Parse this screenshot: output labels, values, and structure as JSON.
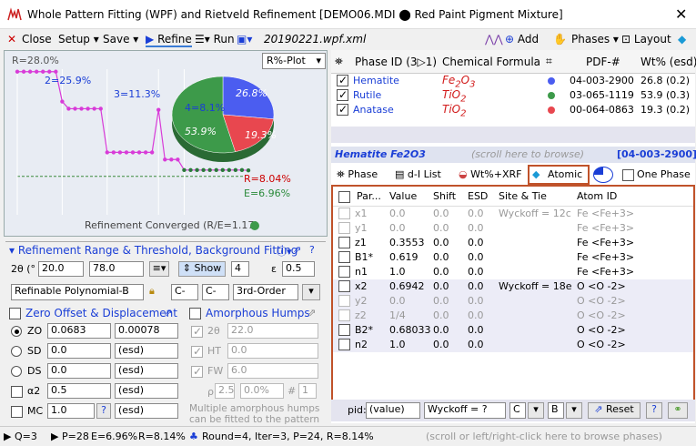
{
  "window": {
    "title": "Whole Pattern Fitting (WPF) and Rietveld Refinement [DEMO06.MDI ⬤ Red Paint Pigment Mixture]",
    "close": "✕"
  },
  "toolbar": {
    "close": "Close",
    "setup": "Setup",
    "save": "Save",
    "refine": "Refine",
    "run": "Run",
    "filename": "20190221.wpf.xml",
    "add": "Add",
    "phases": "Phases",
    "layout": "Layout"
  },
  "plot": {
    "mode": "R%-Plot",
    "r_start": "R=28.0%",
    "label_2": "2=25.9%",
    "label_3": "3=11.3%",
    "label_4": "4=8.1%",
    "r_final": "R=8.04%",
    "e_final": "E=6.96%",
    "status": "Refinement Converged (R/E=1.17)",
    "pie_values": [
      {
        "label": "26.8%",
        "value": 26.8,
        "color": "#4b5df0"
      },
      {
        "label": "19.3%",
        "value": 19.3,
        "color": "#e8474f"
      },
      {
        "label": "53.9%",
        "value": 53.9,
        "color": "#3d9a4a"
      }
    ],
    "r_values": [
      25.9,
      25.9,
      25.9,
      25.9,
      25.9,
      25.9,
      25.9,
      20.5,
      19.2,
      19.2,
      19.2,
      19.2,
      19.2,
      19.2,
      11.3,
      11.3,
      11.3,
      11.3,
      11.3,
      11.3,
      11.3,
      11.3,
      19.0,
      10.0,
      10.0,
      10.0,
      8.1,
      8.1,
      8.1,
      8.1,
      8.1,
      8.1,
      8.1,
      8.1,
      8.1,
      8.1,
      8.04
    ]
  },
  "range": {
    "title": "Refinement Range & Threshold, Background Fitting",
    "two_theta_label": "2θ (°",
    "from": "20.0",
    "to": "78.0",
    "show": "Show",
    "n": "4",
    "eps_label": "ε",
    "eps": "0.5",
    "bg_mode": "Refinable Polynomial-B",
    "c1": "C-",
    "c2": "C-",
    "order": "3rd-Order"
  },
  "zero": {
    "title": "Zero Offset & Displacement",
    "zo_label": "ZO",
    "zo_value": "0.0683",
    "zo_esd": "0.00078",
    "sd_label": "SD",
    "sd_value": "0.0",
    "sd_esd": "(esd)",
    "ds_label": "DS",
    "ds_value": "0.0",
    "ds_esd": "(esd)",
    "a2_label": "α2",
    "a2_value": "0.5",
    "a2_esd": "(esd)",
    "mc_label": "MC",
    "mc_value": "1.0",
    "mc_q": "?",
    "mc_esd": "(esd)"
  },
  "humps": {
    "title": "Amorphous Humps",
    "tt_label": "2θ",
    "tt_value": "22.0",
    "ht_label": "HT",
    "ht_value": "0.0",
    "fw_label": "FW",
    "fw_value": "6.0",
    "rho_label": "ρ",
    "rho_value": "2.5",
    "pct": "0.0%",
    "hash": "#",
    "num": "1",
    "note": "Multiple amorphous humps can be fitted to the pattern"
  },
  "phases_table": {
    "headers": [
      "Phase ID (3▷1)",
      "Chemical Formula",
      "PDF-#",
      "Wt% (esd)"
    ],
    "rows": [
      {
        "name": "Hematite",
        "formula": "Fe2O3",
        "pdf": "04-003-2900",
        "wt": "26.8 (0.2)",
        "dot": "#4b5df0"
      },
      {
        "name": "Rutile",
        "formula": "TiO2",
        "pdf": "03-065-1119",
        "wt": "53.9 (0.3)",
        "dot": "#3d9a4a"
      },
      {
        "name": "Anatase",
        "formula": "TiO2",
        "pdf": "00-064-0863",
        "wt": "19.3 (0.2)",
        "dot": "#e8474f"
      }
    ]
  },
  "phase_header": {
    "name": "Hematite Fe2O3",
    "hint": "(scroll here to browse)",
    "pdf": "[04-003-2900]"
  },
  "tabs": {
    "phase": "Phase",
    "dlist": "d-I List",
    "wtxrf": "Wt%+XRF",
    "atomic": "Atomic",
    "one_phase": "One Phase"
  },
  "atoms": {
    "headers": [
      "Par...",
      "Value",
      "Shift",
      "ESD",
      "Site & Tie",
      "Atom ID"
    ],
    "rows": [
      {
        "par": "x1",
        "value": "0.0",
        "shift": "0.0",
        "esd": "0.0",
        "site": "Wyckoff = 12c",
        "atom": "Fe <Fe+3>",
        "gray": true
      },
      {
        "par": "y1",
        "value": "0.0",
        "shift": "0.0",
        "esd": "0.0",
        "site": "",
        "atom": "Fe <Fe+3>",
        "gray": true
      },
      {
        "par": "z1",
        "value": "0.3553",
        "shift": "0.0",
        "esd": "0.0",
        "site": "",
        "atom": "Fe <Fe+3>",
        "gray": false
      },
      {
        "par": "B1*",
        "value": "0.619",
        "shift": "0.0",
        "esd": "0.0",
        "site": "",
        "atom": "Fe <Fe+3>",
        "gray": false
      },
      {
        "par": "n1",
        "value": "1.0",
        "shift": "0.0",
        "esd": "0.0",
        "site": "",
        "atom": "Fe <Fe+3>",
        "gray": false
      },
      {
        "par": "x2",
        "value": "0.6942",
        "shift": "0.0",
        "esd": "0.0",
        "site": "Wyckoff = 18e",
        "atom": "O <O -2>",
        "gray": false
      },
      {
        "par": "y2",
        "value": "0.0",
        "shift": "0.0",
        "esd": "0.0",
        "site": "",
        "atom": "O <O -2>",
        "gray": true
      },
      {
        "par": "z2",
        "value": "1/4",
        "shift": "0.0",
        "esd": "0.0",
        "site": "",
        "atom": "O <O -2>",
        "gray": true
      },
      {
        "par": "B2*",
        "value": "0.68033",
        "shift": "0.0",
        "esd": "0.0",
        "site": "",
        "atom": "O <O -2>",
        "gray": false
      },
      {
        "par": "n2",
        "value": "1.0",
        "shift": "0.0",
        "esd": "0.0",
        "site": "",
        "atom": "O <O -2>",
        "gray": false
      }
    ]
  },
  "bottom_bar": {
    "pid_label": "pid:",
    "pid_value": "(value)",
    "wyckoff": "Wyckoff = ?",
    "c": "C",
    "b": "B",
    "reset": "Reset"
  },
  "status": {
    "q": "Q=3",
    "p": "P=28",
    "e": "E=6.96%",
    "r": "R=8.14%",
    "round": "Round=4, Iter=3, P=24, R=8.14%",
    "hint": "(scroll or left/right-click here to browse phases)"
  }
}
